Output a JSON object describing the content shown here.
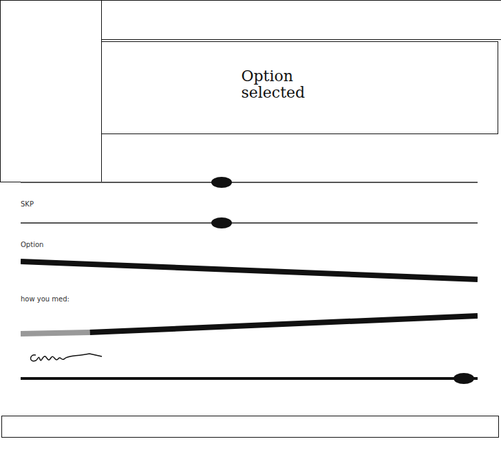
{
  "main_panel": {
    "text": "Option selected"
  },
  "controls": [
    {
      "label": "",
      "kind": "slider",
      "level": 0.44
    },
    {
      "label": "SKP",
      "kind": "slider",
      "level": 0.44
    },
    {
      "label": "Option",
      "kind": "falling",
      "level": 1
    },
    {
      "label": "how you med:",
      "kind": "rising",
      "level": 1
    },
    {
      "label": "",
      "kind": "signed-slider",
      "level": 0.97
    }
  ]
}
